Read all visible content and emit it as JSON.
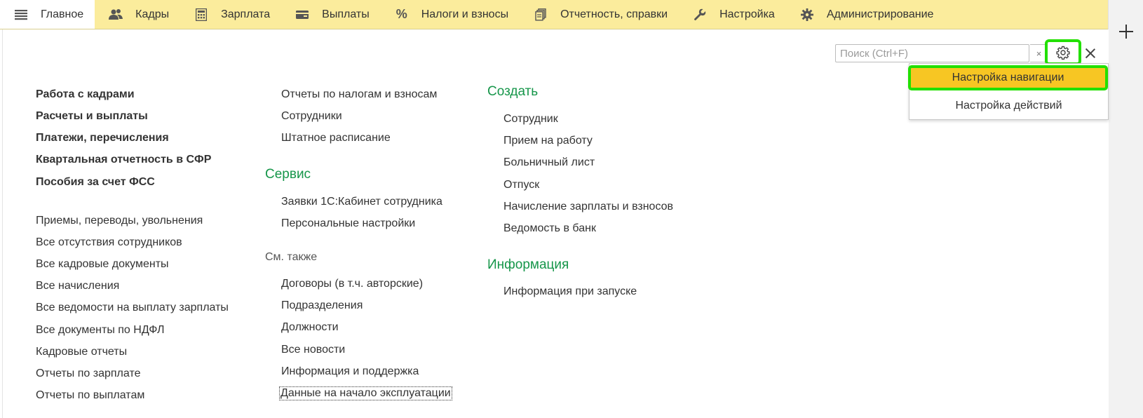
{
  "tabs": [
    {
      "label": "Главное",
      "icon": "menu-lines-icon",
      "active": true
    },
    {
      "label": "Кадры",
      "icon": "people-icon"
    },
    {
      "label": "Зарплата",
      "icon": "calculator-icon"
    },
    {
      "label": "Выплаты",
      "icon": "wallet-icon"
    },
    {
      "label": "Налоги и взносы",
      "icon": "percent-icon"
    },
    {
      "label": "Отчетность, справки",
      "icon": "documents-icon"
    },
    {
      "label": "Настройка",
      "icon": "wrench-icon"
    },
    {
      "label": "Администрирование",
      "icon": "gear-icon"
    }
  ],
  "search": {
    "placeholder": "Поиск (Ctrl+F)",
    "clear_label": "×"
  },
  "dropdown": {
    "items": [
      "Настройка навигации",
      "Настройка действий"
    ]
  },
  "col1": {
    "bold_links": [
      "Работа с кадрами",
      "Расчеты и выплаты",
      "Платежи, перечисления",
      "Квартальная отчетность в СФР",
      "Пособия за счет ФСС"
    ],
    "links": [
      "Приемы, переводы, увольнения",
      "Все отсутствия сотрудников",
      "Все кадровые документы",
      "Все начисления",
      "Все ведомости на выплату зарплаты",
      "Все документы по НДФЛ",
      "Кадровые отчеты",
      "Отчеты по зарплате",
      "Отчеты по выплатам"
    ]
  },
  "col2": {
    "top_links": [
      "Отчеты по налогам и взносам",
      "Сотрудники",
      "Штатное расписание"
    ],
    "service_title": "Сервис",
    "service_links": [
      "Заявки 1С:Кабинет сотрудника",
      "Персональные настройки"
    ],
    "see_also_title": "См. также",
    "see_also_links": [
      "Договоры (в т.ч. авторские)",
      "Подразделения",
      "Должности",
      "Все новости",
      "Информация и поддержка",
      "Данные на начало эксплуатации"
    ]
  },
  "col3": {
    "create_title": "Создать",
    "create_links": [
      "Сотрудник",
      "Прием на работу",
      "Больничный лист",
      "Отпуск",
      "Начисление зарплаты и взносов",
      "Ведомость в банк"
    ],
    "info_title": "Информация",
    "info_links": [
      "Информация при запуске"
    ]
  },
  "colors": {
    "topbar": "#fbec9c",
    "heading_green": "#16964a",
    "highlight_yellow": "#f7c623",
    "focus_green": "#22e000"
  }
}
